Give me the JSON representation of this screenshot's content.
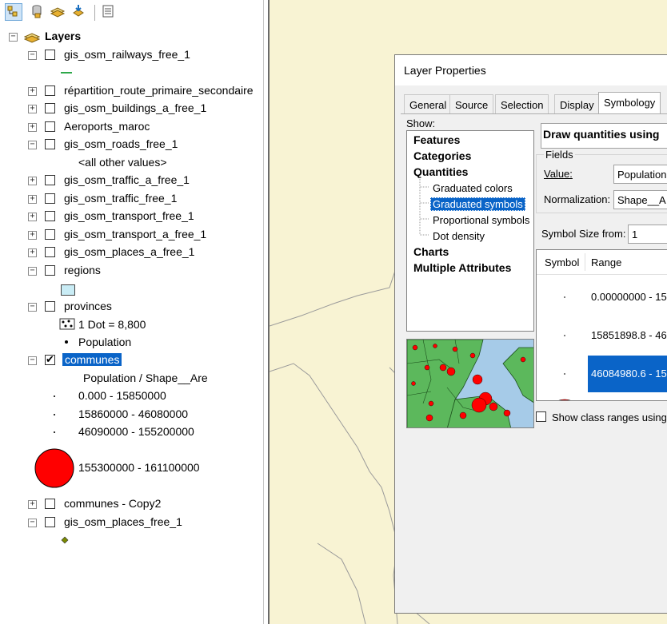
{
  "toc": {
    "root_label": "Layers",
    "layers": [
      {
        "name": "gis_osm_railways_free_1",
        "expanded": true,
        "checked": false
      },
      {
        "name": "répartition_route_primaire_secondaire",
        "expanded": false,
        "checked": false
      },
      {
        "name": "gis_osm_buildings_a_free_1",
        "expanded": false,
        "checked": false
      },
      {
        "name": "Aeroports_maroc",
        "expanded": false,
        "checked": false
      },
      {
        "name": "gis_osm_roads_free_1",
        "expanded": true,
        "checked": false
      },
      {
        "name": "gis_osm_traffic_a_free_1",
        "expanded": false,
        "checked": false
      },
      {
        "name": "gis_osm_traffic_free_1",
        "expanded": false,
        "checked": false
      },
      {
        "name": "gis_osm_transport_free_1",
        "expanded": false,
        "checked": false
      },
      {
        "name": "gis_osm_transport_a_free_1",
        "expanded": false,
        "checked": false
      },
      {
        "name": "gis_osm_places_a_free_1",
        "expanded": false,
        "checked": false
      },
      {
        "name": "regions",
        "expanded": true,
        "checked": false
      },
      {
        "name": "provinces",
        "expanded": true,
        "checked": false
      },
      {
        "name": "communes",
        "expanded": true,
        "checked": true
      },
      {
        "name": "communes - Copy2",
        "expanded": false,
        "checked": false
      },
      {
        "name": "gis_osm_places_free_1",
        "expanded": true,
        "checked": false
      }
    ],
    "roads_other_values": "<all other values>",
    "provinces_dot": "1 Dot = 8,800",
    "provinces_population": "Population",
    "communes_field": "Population / Shape__Are",
    "communes_classes": [
      "0.000 - 15850000",
      "15860000 - 46080000",
      "46090000 - 155200000",
      "155300000 - 161100000"
    ],
    "colors": {
      "selected": "#0a64c8",
      "railway": "#2ea84a",
      "region_fill": "#c9ecf5",
      "big_circle": "#ff0000",
      "place_point": "#7a8a00"
    }
  },
  "dialog": {
    "title": "Layer Properties",
    "tabs": [
      "General",
      "Source",
      "Selection",
      "Display",
      "Symbology"
    ],
    "active_tab": "Symbology",
    "show_label": "Show:",
    "show_items": {
      "features": "Features",
      "categories": "Categories",
      "quantities": "Quantities",
      "graduated_colors": "Graduated colors",
      "graduated_symbols": "Graduated symbols",
      "proportional_symbols": "Proportional symbols",
      "dot_density": "Dot density",
      "charts": "Charts",
      "multiple_attributes": "Multiple Attributes"
    },
    "draw_title": "Draw quantities using",
    "fields_label": "Fields",
    "value_label": "Value:",
    "value": "Population",
    "normalization_label": "Normalization:",
    "normalization": "Shape__A",
    "symbol_size_label": "Symbol Size from:",
    "symbol_size_from": "1",
    "columns": {
      "symbol": "Symbol",
      "range": "Range"
    },
    "ranges": [
      "0.00000000 - 15",
      "15851898.8 - 46",
      "46084980.6 - 15"
    ],
    "show_class_ranges": "Show class ranges using"
  }
}
